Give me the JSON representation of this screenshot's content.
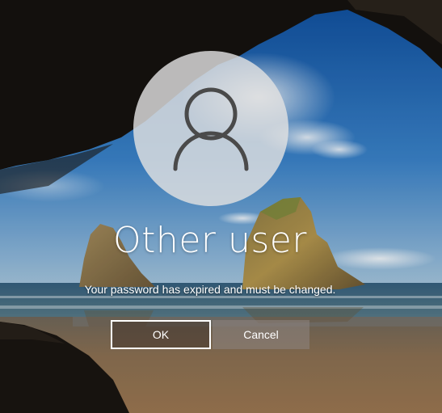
{
  "user": {
    "name": "Other user",
    "avatar_icon": "user-silhouette-icon"
  },
  "status": {
    "message": "Your password has expired and must be changed."
  },
  "buttons": {
    "ok_label": "OK",
    "cancel_label": "Cancel"
  },
  "colors": {
    "avatar_bg": "#e1e1e1",
    "avatar_glyph": "#4a4a4a",
    "text": "#ffffff",
    "ok_border": "#ffffff"
  }
}
